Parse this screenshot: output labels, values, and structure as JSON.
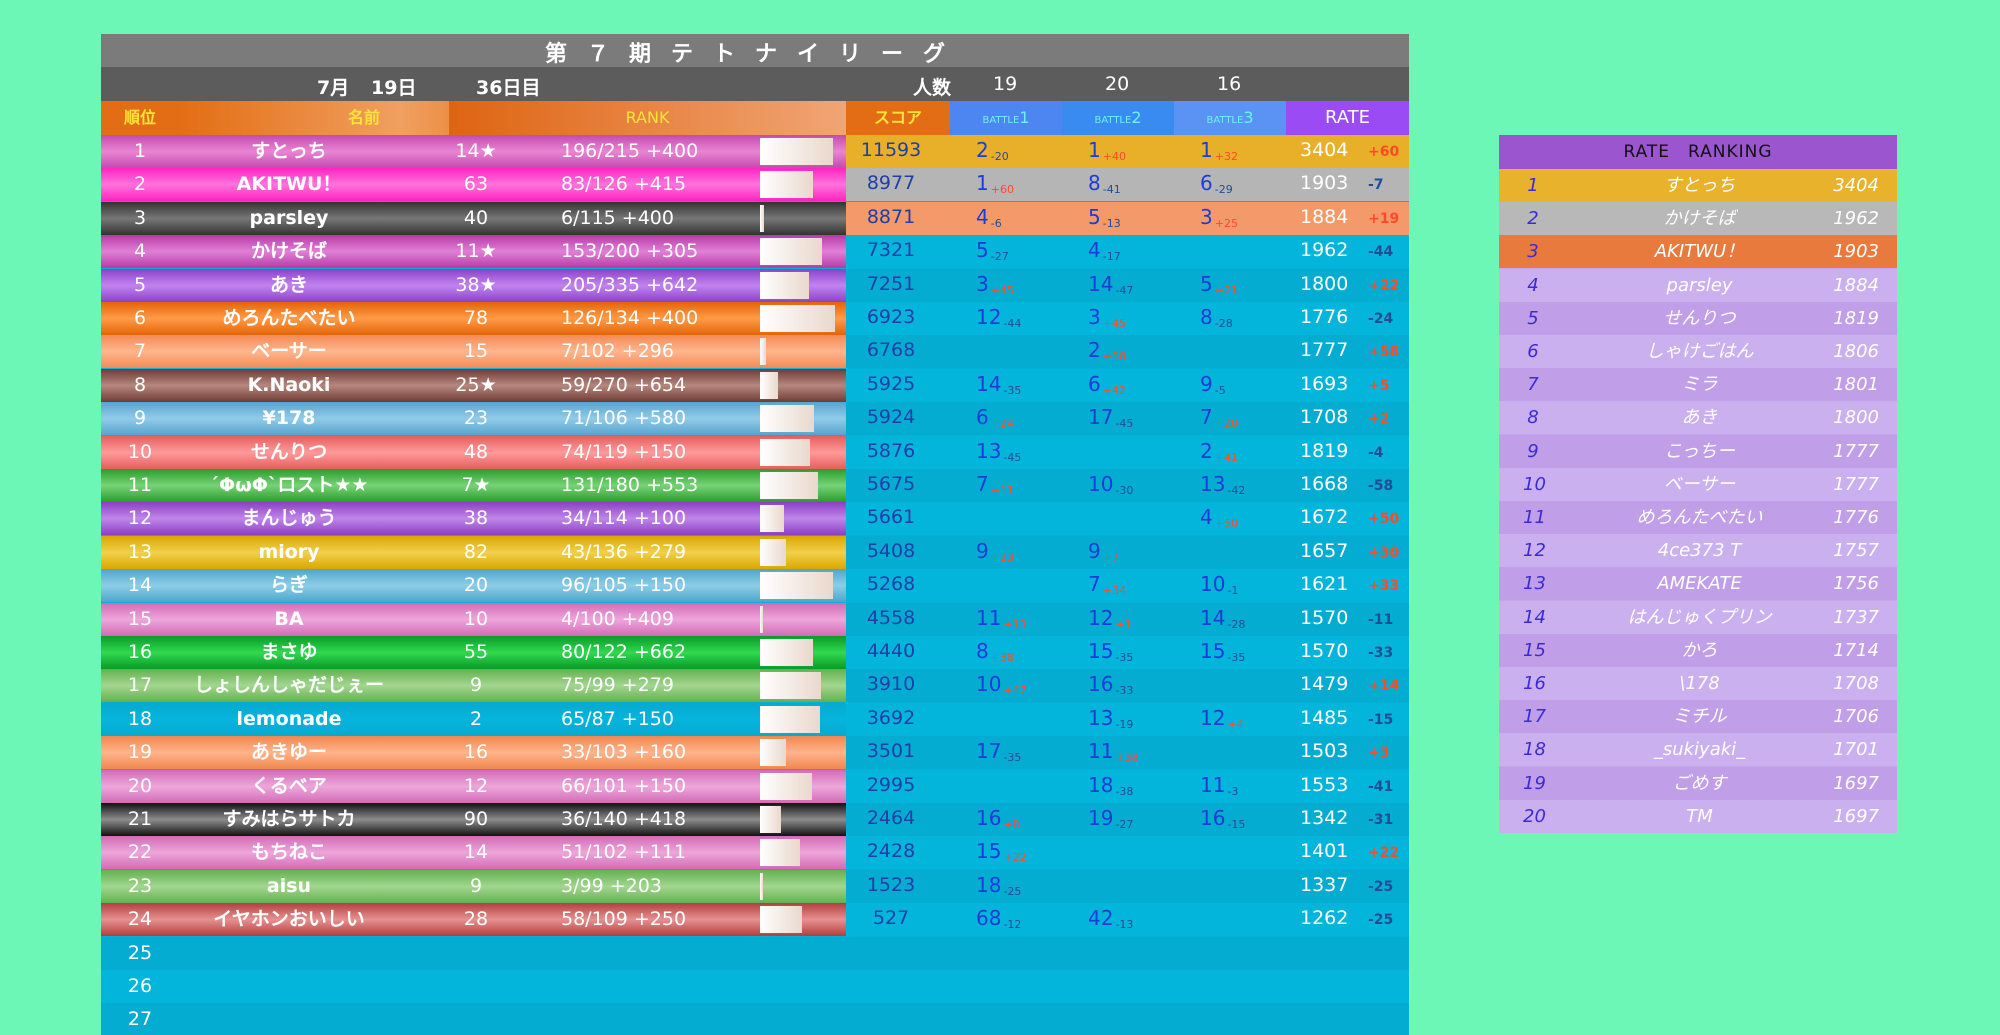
{
  "title": "第７期テトナイリーグ",
  "date": {
    "month": "7月",
    "day": "19日",
    "days": "36日目",
    "players_label": "人数",
    "count1": "19",
    "count2": "20",
    "count3": "16"
  },
  "headers": {
    "rank": "順位",
    "name": "名前",
    "rankcol": "RANK",
    "score": "スコア",
    "b1_small": "BATTLE",
    "b1_num": "1",
    "b2_small": "BATTLE",
    "b2_num": "2",
    "b3_small": "BATTLE",
    "b3_num": "3",
    "rate": "RATE"
  },
  "colors": {
    "background": "#6cf7b6",
    "table": "#03b0d6",
    "header_orange": "#e16b1c",
    "battle1": "#4d86f0",
    "battle2": "#3a8bf0",
    "battle3": "#4c8cf3",
    "rate_purple": "#9b4bf3",
    "pos": "#ff4a2a",
    "neg": "#1e4f95"
  },
  "rows": [
    {
      "rank": "1",
      "name": "すとっち",
      "lv": "14★",
      "rec": "196/215 +400",
      "prog": 0.91,
      "c1": "#c44ab1",
      "c2": "#e985d2",
      "score": "11593",
      "b1": "2",
      "b1d": "-20",
      "b2": "1",
      "b2d": "+40",
      "b3": "1",
      "b3d": "+32",
      "rate": "3404",
      "rd": "+60",
      "rbg": "#e8b028"
    },
    {
      "rank": "2",
      "name": "AKITWU！",
      "lv": "63",
      "rec": "83/126 +415",
      "prog": 0.66,
      "c1": "#ff23c2",
      "c2": "#ff73dc",
      "score": "8977",
      "b1": "1",
      "b1d": "+60",
      "b2": "8",
      "b2d": "-41",
      "b3": "6",
      "b3d": "-29",
      "rate": "1903",
      "rd": "-7",
      "rbg": "#b5b5b5"
    },
    {
      "rank": "3",
      "name": "parsley",
      "lv": "40",
      "rec": "6/115 +400",
      "prog": 0.05,
      "c1": "#333333",
      "c2": "#777777",
      "score": "8871",
      "b1": "4",
      "b1d": "-6",
      "b2": "5",
      "b2d": "-13",
      "b3": "3",
      "b3d": "+25",
      "rate": "1884",
      "rd": "+19",
      "rbg": "#f49a6a"
    },
    {
      "rank": "4",
      "name": "かけそば",
      "lv": "11★",
      "rec": "153/200 +305",
      "prog": 0.77,
      "c1": "#b43ca8",
      "c2": "#e17fd5",
      "score": "7321",
      "b1": "5",
      "b1d": "-27",
      "b2": "4",
      "b2d": "-17",
      "b3": "",
      "b3d": "",
      "rate": "1962",
      "rd": "-44",
      "rbg": ""
    },
    {
      "rank": "5",
      "name": "あき",
      "lv": "38★",
      "rec": "205/335 +642",
      "prog": 0.61,
      "c1": "#8a43c9",
      "c2": "#c283ee",
      "score": "7251",
      "b1": "3",
      "b1d": "+45",
      "b2": "14",
      "b2d": "-47",
      "b3": "5",
      "b3d": "+21",
      "rate": "1800",
      "rd": "+22",
      "rbg": ""
    },
    {
      "rank": "6",
      "name": "めろんたべたい",
      "lv": "78",
      "rec": "126/134 +400",
      "prog": 0.94,
      "c1": "#e36408",
      "c2": "#ff9b48",
      "score": "6923",
      "b1": "12",
      "b1d": "-44",
      "b2": "3",
      "b2d": "+45",
      "b3": "8",
      "b3d": "-28",
      "rate": "1776",
      "rd": "-24",
      "rbg": ""
    },
    {
      "rank": "7",
      "name": "ベーサー",
      "lv": "15",
      "rec": "7/102 +296",
      "prog": 0.07,
      "c1": "#f38a55",
      "c2": "#ffb68d",
      "score": "6768",
      "b1": "",
      "b1d": "",
      "b2": "2",
      "b2d": "+58",
      "b3": "",
      "b3d": "",
      "rate": "1777",
      "rd": "+58",
      "rbg": ""
    },
    {
      "rank": "8",
      "name": "K.Naoki",
      "lv": "25★",
      "rec": "59/270 +654",
      "prog": 0.22,
      "c1": "#6e3c34",
      "c2": "#b5877e",
      "score": "5925",
      "b1": "14",
      "b1d": "-35",
      "b2": "6",
      "b2d": "+42",
      "b3": "9",
      "b3d": "-5",
      "rate": "1693",
      "rd": "+5",
      "rbg": ""
    },
    {
      "rank": "9",
      "name": "¥178",
      "lv": "23",
      "rec": "71/106 +580",
      "prog": 0.67,
      "c1": "#56a5cf",
      "c2": "#92cbe8",
      "score": "5924",
      "b1": "6",
      "b1d": "+24",
      "b2": "17",
      "b2d": "-45",
      "b3": "7",
      "b3d": "+20",
      "rate": "1708",
      "rd": "+2",
      "rbg": ""
    },
    {
      "rank": "10",
      "name": "せんりつ",
      "lv": "48",
      "rec": "74/119 +150",
      "prog": 0.62,
      "c1": "#e65e5e",
      "c2": "#ff9a9a",
      "score": "5876",
      "b1": "13",
      "b1d": "-45",
      "b2": "",
      "b2d": "",
      "b3": "2",
      "b3d": "+41",
      "rate": "1819",
      "rd": "-4",
      "rbg": ""
    },
    {
      "rank": "11",
      "name": "´ΦωΦ`ロスト★★",
      "lv": "7★",
      "rec": "131/180 +553",
      "prog": 0.73,
      "c1": "#2b9c2b",
      "c2": "#77d377",
      "score": "5675",
      "b1": "7",
      "b1d": "+11",
      "b2": "10",
      "b2d": "-30",
      "b3": "13",
      "b3d": "-42",
      "rate": "1668",
      "rd": "-58",
      "rbg": ""
    },
    {
      "rank": "12",
      "name": "まんじゅう",
      "lv": "38",
      "rec": "34/114 +100",
      "prog": 0.3,
      "c1": "#8b3fc4",
      "c2": "#bf86e8",
      "score": "5661",
      "b1": "",
      "b1d": "",
      "b2": "",
      "b2d": "",
      "b3": "4",
      "b3d": "+50",
      "rate": "1672",
      "rd": "+50",
      "rbg": ""
    },
    {
      "rank": "13",
      "name": "miory",
      "lv": "82",
      "rec": "43/136 +279",
      "prog": 0.32,
      "c1": "#d9a700",
      "c2": "#f2d04c",
      "score": "5408",
      "b1": "9",
      "b1d": "+23",
      "b2": "9",
      "b2d": "+7",
      "b3": "",
      "b3d": "",
      "rate": "1657",
      "rd": "+30",
      "rbg": ""
    },
    {
      "rank": "14",
      "name": "らぎ",
      "lv": "20",
      "rec": "96/105 +150",
      "prog": 0.91,
      "c1": "#4ba7cb",
      "c2": "#8dcde8",
      "score": "5268",
      "b1": "",
      "b1d": "",
      "b2": "7",
      "b2d": "+34",
      "b3": "10",
      "b3d": "-1",
      "rate": "1621",
      "rd": "+33",
      "rbg": ""
    },
    {
      "rank": "15",
      "name": "BA",
      "lv": "10",
      "rec": "4/100 +409",
      "prog": 0.04,
      "c1": "#d26bb7",
      "c2": "#eea6da",
      "score": "4558",
      "b1": "11",
      "b1d": "+13",
      "b2": "12",
      "b2d": "+1",
      "b3": "14",
      "b3d": "-28",
      "rate": "1570",
      "rd": "-11",
      "rbg": ""
    },
    {
      "rank": "16",
      "name": "まさゆ",
      "lv": "55",
      "rec": "80/122 +662",
      "prog": 0.66,
      "c1": "#0a9a28",
      "c2": "#30d94f",
      "score": "4440",
      "b1": "8",
      "b1d": "+38",
      "b2": "15",
      "b2d": "-35",
      "b3": "15",
      "b3d": "-35",
      "rate": "1570",
      "rd": "-33",
      "rbg": ""
    },
    {
      "rank": "17",
      "name": "しょしんしゃだじぇー",
      "lv": "9",
      "rec": "75/99 +279",
      "prog": 0.76,
      "c1": "#64b14f",
      "c2": "#a2d690",
      "score": "3910",
      "b1": "10",
      "b1d": "+47",
      "b2": "16",
      "b2d": "-33",
      "b3": "",
      "b3d": "",
      "rate": "1479",
      "rd": "+14",
      "rbg": ""
    },
    {
      "rank": "18",
      "name": "lemonade",
      "lv": "2",
      "rec": "65/87 +150",
      "prog": 0.75,
      "c1": "#07a9cf",
      "c2": "#06b4dc",
      "score": "3692",
      "b1": "",
      "b1d": "",
      "b2": "13",
      "b2d": "-19",
      "b3": "12",
      "b3d": "+4",
      "rate": "1485",
      "rd": "-15",
      "rbg": ""
    },
    {
      "rank": "19",
      "name": "あきゆー",
      "lv": "16",
      "rec": "33/103 +160",
      "prog": 0.32,
      "c1": "#f0874f",
      "c2": "#ffb48b",
      "score": "3501",
      "b1": "17",
      "b1d": "-35",
      "b2": "11",
      "b2d": "+38",
      "b3": "",
      "b3d": "",
      "rate": "1503",
      "rd": "+3",
      "rbg": ""
    },
    {
      "rank": "20",
      "name": "くるベア",
      "lv": "12",
      "rec": "66/101 +150",
      "prog": 0.65,
      "c1": "#d26bb7",
      "c2": "#eda7da",
      "score": "2995",
      "b1": "",
      "b1d": "",
      "b2": "18",
      "b2d": "-38",
      "b3": "11",
      "b3d": "-3",
      "rate": "1553",
      "rd": "-41",
      "rbg": ""
    },
    {
      "rank": "21",
      "name": "すみはらサトカ",
      "lv": "90",
      "rec": "36/140 +418",
      "prog": 0.26,
      "c1": "#111111",
      "c2": "#8d8d8d",
      "score": "2464",
      "b1": "16",
      "b1d": "+8",
      "b2": "19",
      "b2d": "-27",
      "b3": "16",
      "b3d": "-15",
      "rate": "1342",
      "rd": "-31",
      "rbg": ""
    },
    {
      "rank": "22",
      "name": "もちねこ",
      "lv": "14",
      "rec": "51/102 +111",
      "prog": 0.5,
      "c1": "#d36ab6",
      "c2": "#eda6d9",
      "score": "2428",
      "b1": "15",
      "b1d": "+22",
      "b2": "",
      "b2d": "",
      "b3": "",
      "b3d": "",
      "rate": "1401",
      "rd": "+22",
      "rbg": ""
    },
    {
      "rank": "23",
      "name": "aisu",
      "lv": "9",
      "rec": "3/99 +203",
      "prog": 0.03,
      "c1": "#64b14f",
      "c2": "#a2d690",
      "score": "1523",
      "b1": "18",
      "b1d": "-25",
      "b2": "",
      "b2d": "",
      "b3": "",
      "b3d": "",
      "rate": "1337",
      "rd": "-25",
      "rbg": ""
    },
    {
      "rank": "24",
      "name": "イヤホンおいしい",
      "lv": "28",
      "rec": "58/109 +250",
      "prog": 0.53,
      "c1": "#b33e3e",
      "c2": "#e59191",
      "score": "527",
      "b1": "68",
      "b1d": "-12",
      "b2": "42",
      "b2d": "-13",
      "b3": "",
      "b3d": "",
      "rate": "1262",
      "rd": "-25",
      "rbg": ""
    }
  ],
  "empty_ranks": [
    "25",
    "26",
    "27"
  ],
  "rate_ranking": {
    "title": "RATE　RANKING",
    "items": [
      {
        "n": "1",
        "name": "すとっち",
        "v": "3404",
        "bg": "#e8b22c"
      },
      {
        "n": "2",
        "name": "かけそば",
        "v": "1962",
        "bg": "#b8b8b8"
      },
      {
        "n": "3",
        "name": "AKITWU！",
        "v": "1903",
        "bg": "#e87a3d"
      },
      {
        "n": "4",
        "name": "parsley",
        "v": "1884",
        "bg": ""
      },
      {
        "n": "5",
        "name": "せんりつ",
        "v": "1819",
        "bg": ""
      },
      {
        "n": "6",
        "name": "しゃけごはん",
        "v": "1806",
        "bg": ""
      },
      {
        "n": "7",
        "name": "ミラ",
        "v": "1801",
        "bg": ""
      },
      {
        "n": "8",
        "name": "あき",
        "v": "1800",
        "bg": ""
      },
      {
        "n": "9",
        "name": "こっちー",
        "v": "1777",
        "bg": ""
      },
      {
        "n": "10",
        "name": "ベーサー",
        "v": "1777",
        "bg": ""
      },
      {
        "n": "11",
        "name": "めろんたべたい",
        "v": "1776",
        "bg": ""
      },
      {
        "n": "12",
        "name": "4ce373 T",
        "v": "1757",
        "bg": ""
      },
      {
        "n": "13",
        "name": "AMEKATE",
        "v": "1756",
        "bg": ""
      },
      {
        "n": "14",
        "name": "はんじゅくプリン",
        "v": "1737",
        "bg": ""
      },
      {
        "n": "15",
        "name": "かろ",
        "v": "1714",
        "bg": ""
      },
      {
        "n": "16",
        "name": "\\178",
        "v": "1708",
        "bg": ""
      },
      {
        "n": "17",
        "name": "ミチル",
        "v": "1706",
        "bg": ""
      },
      {
        "n": "18",
        "name": "_sukiyaki_",
        "v": "1701",
        "bg": ""
      },
      {
        "n": "19",
        "name": "ごめす",
        "v": "1697",
        "bg": ""
      },
      {
        "n": "20",
        "name": "TM",
        "v": "1697",
        "bg": ""
      }
    ]
  }
}
